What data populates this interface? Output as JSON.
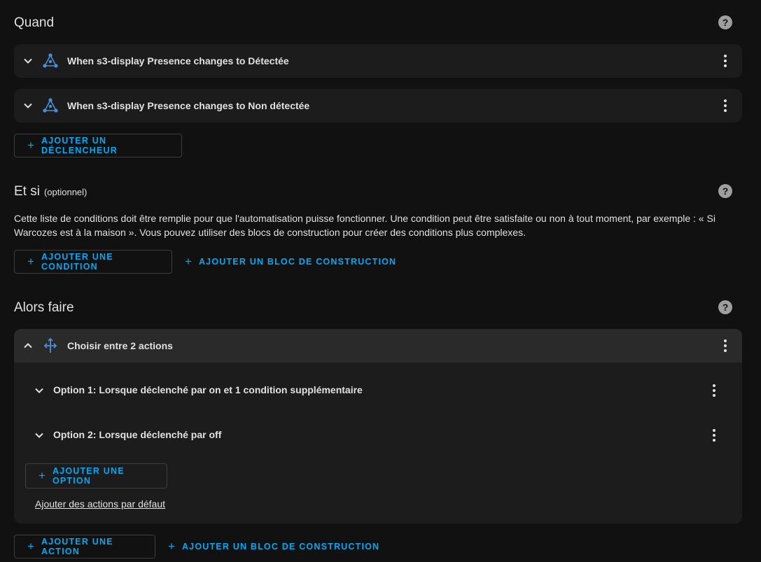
{
  "triggers": {
    "title": "Quand",
    "help_icon": "?",
    "items": [
      {
        "label": "When s3-display Presence changes to Détectée"
      },
      {
        "label": "When s3-display Presence changes to Non détectée"
      }
    ],
    "add_button": "AJOUTER UN DÉCLENCHEUR"
  },
  "conditions": {
    "title": "Et si",
    "subtitle": "(optionnel)",
    "help_icon": "?",
    "description": "Cette liste de conditions doit être remplie pour que l'automatisation puisse fonctionner. Une condition peut être satisfaite ou non à tout moment, par exemple : « Si Warcozes est à la maison ». Vous pouvez utiliser des blocs de construction pour créer des conditions plus complexes.",
    "add_button": "AJOUTER UNE CONDITION",
    "add_block_button": "AJOUTER UN BLOC DE CONSTRUCTION"
  },
  "actions": {
    "title": "Alors faire",
    "help_icon": "?",
    "choose": {
      "label": "Choisir entre 2 actions",
      "options": [
        {
          "label": "Option 1: Lorsque déclenché par on et 1 condition supplémentaire"
        },
        {
          "label": "Option 2: Lorsque déclenché par off"
        }
      ],
      "add_option_button": "AJOUTER UNE OPTION",
      "default_link": "Ajouter des actions par défaut"
    },
    "add_button": "AJOUTER UNE ACTION",
    "add_block_button": "AJOUTER UN BLOC DE CONSTRUCTION"
  },
  "icons": {
    "trigger": "trigger-graph-icon",
    "choose": "choose-arrows-icon",
    "expand": "chevron-down-icon",
    "collapse": "chevron-up-icon",
    "menu": "dots-vertical-icon",
    "help": "help-circle-icon",
    "add": "plus-icon"
  },
  "colors": {
    "accent": "#03a9f4",
    "background": "#111111",
    "card": "#1c1c1c",
    "icon": "#4a8fd9"
  }
}
